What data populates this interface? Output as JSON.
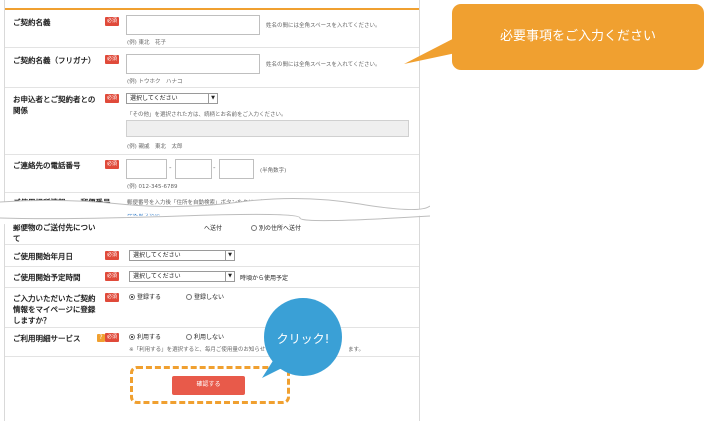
{
  "callout": {
    "text": "必要事項をご入力ください"
  },
  "click_bubble": {
    "text": "クリック!"
  },
  "required_badge": "必須",
  "help_badge": "?",
  "form": {
    "contract_name": {
      "label": "ご契約名義",
      "note": "姓名の間には全角スペースを入れてください。",
      "example": "(例) 東北　花子"
    },
    "contract_kana": {
      "label": "ご契約名義（フリガナ）",
      "note": "姓名の間には全角スペースを入れてください。",
      "example": "(例) トウホク　ハナコ"
    },
    "relationship": {
      "label": "お申込者とご契約者との関係",
      "select_value": "選択してください",
      "note": "「その他」を選択された方は、続柄とお名前をご入力ください。",
      "example": "(例) 親戚　東北　太郎"
    },
    "phone": {
      "label": "ご連絡先の電話番号",
      "note": "(半角数字)",
      "example": "(例) 012-345-6789",
      "separator": "-"
    },
    "postal": {
      "label": "ご使用場所情報　　郵便番号",
      "note": "郵便番号を入力後「住所を自動検索」ボタンをクリックしてください。",
      "search_link": "郵便番号検索"
    },
    "mail_destination": {
      "label": "郵便物のご送付先について",
      "option_other": "別の住所へ送付",
      "option_same": "へ送付"
    },
    "start_date": {
      "label": "ご使用開始年月日",
      "select_value": "選択してください"
    },
    "start_time": {
      "label": "ご使用開始予定時間",
      "select_value": "選択してください",
      "note": "時頃から使用予定"
    },
    "mypage": {
      "label": "ご入力いただいたご契約情報をマイページに登録しますか？",
      "option_yes": "登録する",
      "option_no": "登録しない"
    },
    "billing_service": {
      "label": "ご利用明細サービス",
      "option_yes": "利用する",
      "option_no": "利用しない",
      "note": "※「利用する」を選択すると、毎月ご使用量のお知らせ",
      "note_tail": "ます。"
    }
  },
  "confirm_button": {
    "label": "確認する"
  }
}
